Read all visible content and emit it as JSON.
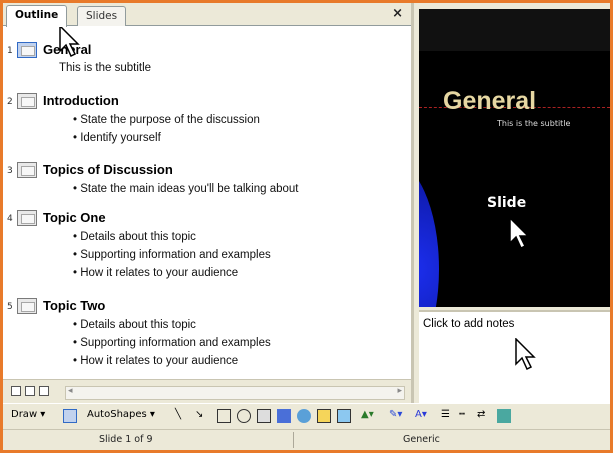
{
  "tabs": {
    "outline": "Outline",
    "slides": "Slides",
    "close": "×"
  },
  "outline": {
    "slides": [
      {
        "number": "1",
        "title": "General",
        "lines": [
          "This is the subtitle"
        ]
      },
      {
        "number": "2",
        "title": "Introduction",
        "lines": [
          "• State the purpose of the discussion",
          "• Identify yourself"
        ]
      },
      {
        "number": "3",
        "title": "Topics of Discussion",
        "lines": [
          "• State the main ideas you'll be talking about"
        ]
      },
      {
        "number": "4",
        "title": "Topic One",
        "lines": [
          "• Details about this topic",
          "• Supporting information and examples",
          "• How it relates to your audience"
        ]
      },
      {
        "number": "5",
        "title": "Topic Two",
        "lines": [
          "• Details about this topic",
          "• Supporting information and examples",
          "• How it relates to your audience"
        ]
      }
    ]
  },
  "preview": {
    "title": "General",
    "subtitle": "This is the subtitle",
    "label": "Slide"
  },
  "notes": {
    "placeholder": "Click to add notes"
  },
  "draw_toolbar": {
    "draw_label": "Draw",
    "autoshapes_label": "AutoShapes"
  },
  "status": {
    "slide_position": "Slide 1 of 9",
    "design": "Generic"
  },
  "colors": {
    "window_border": "#e87a2a",
    "preview_background": "#000000",
    "preview_title": "#e6d7a2",
    "accent_arc": "#1c2ff0"
  }
}
